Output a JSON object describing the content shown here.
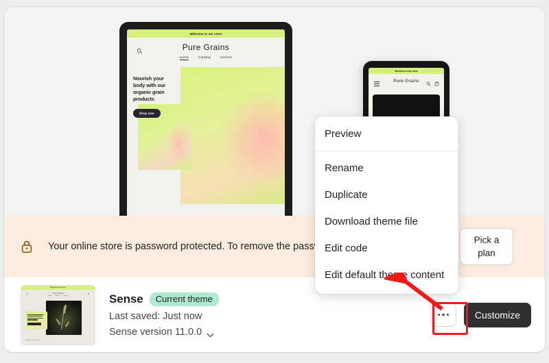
{
  "preview": {
    "desktop": {
      "announcement": "Welcome to our store",
      "store_title": "Pure Grains",
      "nav": [
        "Home",
        "Catalog",
        "Contact"
      ],
      "hero_heading": "Nourish your body with our organic grain products",
      "hero_button": "Shop now",
      "search_icon": "search-icon"
    },
    "mobile": {
      "announcement": "Welcome to our store",
      "store_title": "Pure Grains",
      "menu_icon": "hamburger-icon",
      "search_icon": "search-icon",
      "cart_icon": "cart-icon"
    }
  },
  "banner": {
    "icon": "lock-icon",
    "message": "Your online store is password protected. To remove the password, pick a plan.",
    "button_label": "Pick a plan",
    "background_color": "#fcecdf",
    "icon_color": "#8a6116"
  },
  "theme": {
    "thumbnail": {
      "announcement": "Welcome to our store",
      "store_title": "Pure Grains",
      "nav": [
        "Home",
        "Catalog",
        "Contact"
      ],
      "hero_heading": "Nourish your body with our organic grain products",
      "footer_text": "Features and products"
    },
    "name": "Sense",
    "badge": "Current theme",
    "badge_color": "#aee9d1",
    "last_saved": "Last saved: Just now",
    "version": "Sense version 11.0.0",
    "version_chevron": "chevron-down-icon",
    "more_button": "more-actions-icon",
    "customize_label": "Customize"
  },
  "menu": {
    "items": [
      {
        "label": "Preview",
        "separator_after": true
      },
      {
        "label": "Rename",
        "separator_after": false
      },
      {
        "label": "Duplicate",
        "separator_after": false
      },
      {
        "label": "Download theme file",
        "separator_after": false
      },
      {
        "label": "Edit code",
        "separator_after": false
      },
      {
        "label": "Edit default theme content",
        "separator_after": false
      }
    ]
  },
  "annotation": {
    "highlight_color": "#f51a1a",
    "arrow_target": "more-actions-button",
    "arrow_points_to": "Edit default theme content"
  }
}
